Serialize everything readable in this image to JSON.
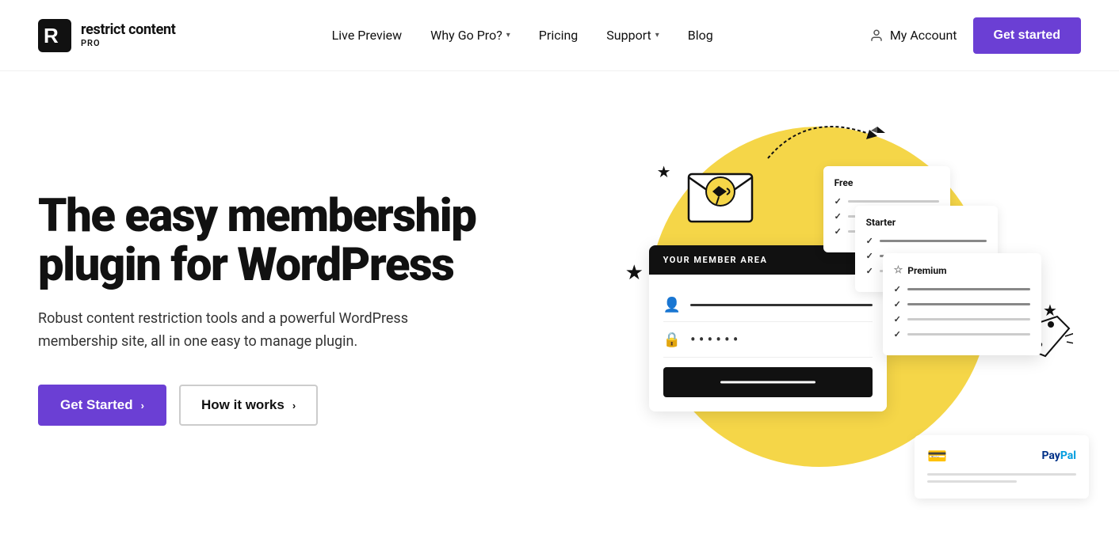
{
  "header": {
    "logo_text_main": "restrict content",
    "logo_text_pro": "PRO",
    "nav": {
      "live_preview": "Live Preview",
      "why_go_pro": "Why Go Pro?",
      "pricing": "Pricing",
      "support": "Support",
      "blog": "Blog"
    },
    "my_account": "My Account",
    "get_started": "Get started"
  },
  "hero": {
    "title": "The easy membership plugin for WordPress",
    "subtitle": "Robust content restriction tools and a powerful WordPress membership site, all in one easy to manage plugin.",
    "btn_primary": "Get Started",
    "btn_secondary": "How it works",
    "member_area_header": "YOUR MEMBER AREA",
    "pricing_free": "Free",
    "pricing_starter": "Starter",
    "pricing_premium": "Premium",
    "paypal_text": "PayPal"
  }
}
